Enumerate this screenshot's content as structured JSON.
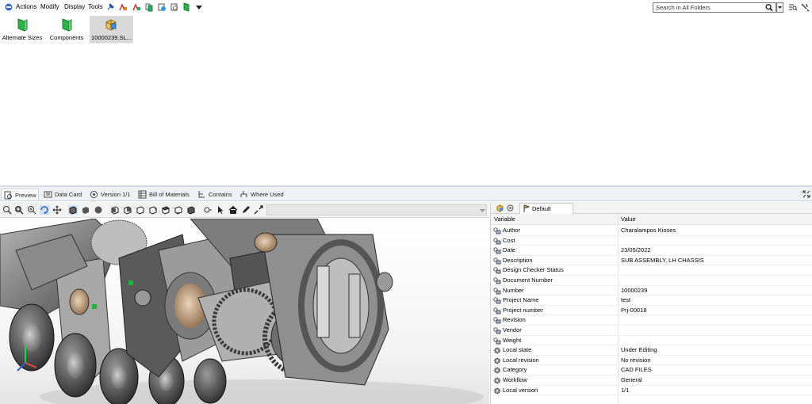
{
  "menubar": {
    "items": [
      "Actions",
      "Modify",
      "Display",
      "Tools"
    ],
    "search_placeholder": "Search in All Folders"
  },
  "folders": [
    {
      "label": "Alternate Sizes",
      "icon": "green-folder-icon"
    },
    {
      "label": "Components",
      "icon": "green-folder-icon"
    },
    {
      "label": "10000239.SL...",
      "icon": "solidworks-assembly-icon",
      "selected": true
    }
  ],
  "tabs": [
    {
      "label": "Preview",
      "icon": "preview-icon",
      "active": true
    },
    {
      "label": "Data Card",
      "icon": "data-card-icon"
    },
    {
      "label": "Version 1/1",
      "icon": "version-icon"
    },
    {
      "label": "Bill of Materials",
      "icon": "bill-of-materials-icon"
    },
    {
      "label": "Contains",
      "icon": "contains-icon"
    },
    {
      "label": "Where Used",
      "icon": "where-used-icon"
    }
  ],
  "datacard": {
    "config_tab": "Default",
    "headers": {
      "variable": "Variable",
      "value": "Value"
    },
    "rows": [
      {
        "variable": "Author",
        "value": "Charalampos Kioses",
        "icon": "variable-icon"
      },
      {
        "variable": "Cost",
        "value": "",
        "icon": "variable-icon"
      },
      {
        "variable": "Date",
        "value": "23/05/2022",
        "icon": "variable-icon"
      },
      {
        "variable": "Description",
        "value": "SUB ASSEMBLY, LH CHASSIS",
        "icon": "variable-icon"
      },
      {
        "variable": "Design Checker Status",
        "value": "",
        "icon": "variable-icon"
      },
      {
        "variable": "Document Number",
        "value": "",
        "icon": "variable-icon"
      },
      {
        "variable": "Number",
        "value": "10000239",
        "icon": "variable-icon"
      },
      {
        "variable": "Project Name",
        "value": "test",
        "icon": "variable-icon"
      },
      {
        "variable": "Project number",
        "value": "Prj-00018",
        "icon": "variable-icon"
      },
      {
        "variable": "Revision",
        "value": "",
        "icon": "variable-icon"
      },
      {
        "variable": "Vendor",
        "value": "",
        "icon": "variable-icon"
      },
      {
        "variable": "Weight",
        "value": "",
        "icon": "variable-icon"
      },
      {
        "variable": "Local state",
        "value": "Under Editing",
        "icon": "gear-icon"
      },
      {
        "variable": "Local revision",
        "value": "No revision",
        "icon": "gear-icon"
      },
      {
        "variable": "Category",
        "value": "CAD FILES",
        "icon": "gear-icon"
      },
      {
        "variable": "Workflow",
        "value": "General",
        "icon": "gear-icon"
      },
      {
        "variable": "Local version",
        "value": "1/1",
        "icon": "gear-icon"
      }
    ]
  },
  "colors": {
    "tab_bar_bg": "#eef1f5",
    "folder_green": "#2fb24a",
    "selection_grey": "#d9d9d9"
  }
}
